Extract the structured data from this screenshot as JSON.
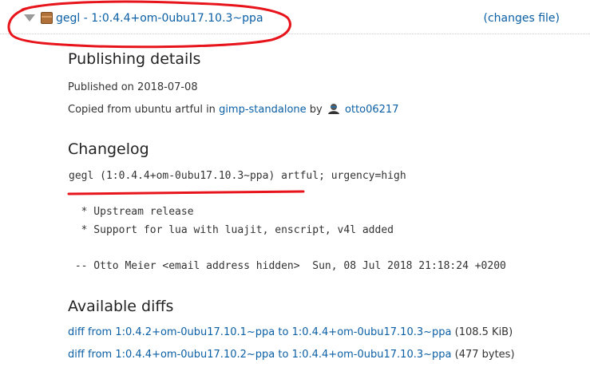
{
  "header": {
    "package_title": "gegl - 1:0.4.4+om-0ubu17.10.3~ppa",
    "changes_file": "(changes file)"
  },
  "publishing": {
    "heading": "Publishing details",
    "published_on": "Published on 2018-07-08",
    "copied_prefix": "Copied from ubuntu artful in",
    "archive": "gimp-standalone",
    "by": "by",
    "user": "otto06217"
  },
  "changelog": {
    "heading": "Changelog",
    "lines": [
      "gegl (1:0.4.4+om-0ubu17.10.3~ppa) artful; urgency=high",
      "",
      "  * Upstream release",
      "  * Support for lua with luajit, enscript, v4l added",
      "",
      " -- Otto Meier <email address hidden>  Sun, 08 Jul 2018 21:18:24 +0200"
    ]
  },
  "diffs": {
    "heading": "Available diffs",
    "items": [
      {
        "link": "diff from 1:0.4.2+om-0ubu17.10.1~ppa to 1:0.4.4+om-0ubu17.10.3~ppa",
        "size": "(108.5 KiB)"
      },
      {
        "link": "diff from 1:0.4.4+om-0ubu17.10.2~ppa to 1:0.4.4+om-0ubu17.10.3~ppa",
        "size": "(477 bytes)"
      }
    ]
  },
  "colors": {
    "link": "#0b5fa5",
    "annotation": "#e8141b"
  },
  "icons": [
    "expander-triangle-icon",
    "package-icon",
    "user-icon"
  ]
}
